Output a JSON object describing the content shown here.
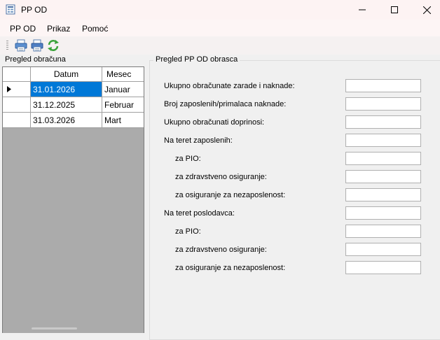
{
  "window": {
    "title": "PP OD"
  },
  "menu": [
    {
      "label": "PP OD"
    },
    {
      "label": "Prikaz"
    },
    {
      "label": "Pomoć"
    }
  ],
  "toolbar": {
    "icons": [
      "printer-icon",
      "printer-preview-icon",
      "refresh-icon"
    ]
  },
  "left_panel": {
    "caption": "Pregled obračuna",
    "columns": [
      "Datum",
      "Mesec"
    ],
    "rows": [
      {
        "date": "31.01.2026",
        "month": "Januar",
        "selected": true
      },
      {
        "date": "31.12.2025",
        "month": "Februar",
        "selected": false
      },
      {
        "date": "31.03.2026",
        "month": "Mart",
        "selected": false
      }
    ]
  },
  "right_panel": {
    "caption": "Pregled PP OD obrasca",
    "fields": [
      {
        "label": "Ukupno obračunate zarade i naknade:",
        "value": ""
      },
      {
        "label": "Broj zaposlenih/primalaca naknade:",
        "value": ""
      },
      {
        "label": "Ukupno obračunati doprinosi:",
        "value": ""
      },
      {
        "label": "Na teret zaposlenih:",
        "value": ""
      },
      {
        "label": "za PIO:",
        "value": ""
      },
      {
        "label": "za zdravstveno osiguranje:",
        "value": ""
      },
      {
        "label": "za osiguranje za nezaposlenost:",
        "value": ""
      },
      {
        "label": "Na teret poslodavca:",
        "value": ""
      },
      {
        "label": "za PIO:",
        "value": ""
      },
      {
        "label": "za zdravstveno osiguranje:",
        "value": ""
      },
      {
        "label": "za osiguranje za nezaposlenost:",
        "value": ""
      }
    ]
  }
}
